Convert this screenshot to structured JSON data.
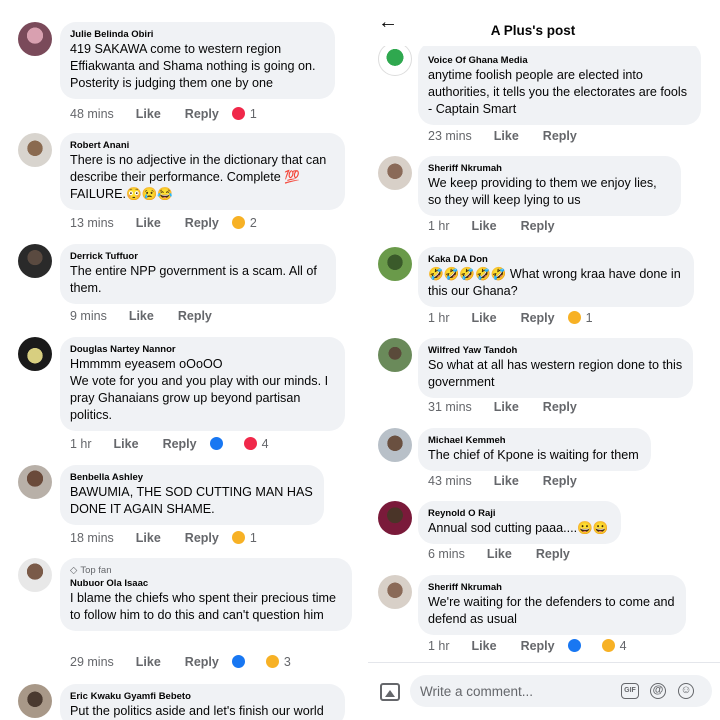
{
  "left_panel": {
    "comments": [
      {
        "author": "Julie Belinda Obiri",
        "text": "419 SAKAWA come to western region Effiakwanta and Shama nothing is going on. Posterity is judging them one by one",
        "time": "48 mins",
        "like": "Like",
        "reply": "Reply",
        "reaction_count": "1",
        "reactions": [
          "love"
        ]
      },
      {
        "author": "Robert Anani",
        "text": "There is no adjective in the dictionary that can describe their performance. Complete 💯 FAILURE.😳😢😂",
        "time": "13 mins",
        "like": "Like",
        "reply": "Reply",
        "reaction_count": "2",
        "reactions": [
          "haha"
        ]
      },
      {
        "author": "Derrick Tuffuor",
        "text": "The entire NPP government is a scam. All of them.",
        "time": "9 mins",
        "like": "Like",
        "reply": "Reply",
        "reaction_count": "",
        "reactions": []
      },
      {
        "author": "Douglas Nartey Nannor",
        "text": "Hmmmm eyeasem oOoOO\nWe vote for you and you play with our minds. I pray Ghanaians grow up beyond partisan politics.",
        "time": "1 hr",
        "like": "Like",
        "reply": "Reply",
        "reaction_count": "4",
        "reactions": [
          "like",
          "love"
        ]
      },
      {
        "author": "Benbella Ashley",
        "text": "BAWUMIA, THE SOD CUTTING  MAN HAS DONE IT AGAIN SHAME.",
        "time": "18 mins",
        "like": "Like",
        "reply": "Reply",
        "reaction_count": "1",
        "reactions": [
          "haha"
        ]
      },
      {
        "author": "Nubuor Ola Isaac",
        "badge": "Top fan",
        "text": "I blame the chiefs who spent their precious time to follow him to do this and can't question him",
        "time": "29 mins",
        "like": "Like",
        "reply": "Reply",
        "reaction_count": "3",
        "reactions": [
          "like",
          "haha"
        ]
      },
      {
        "author": "Eric Kwaku Gyamfi Bebeto",
        "text": "Put the politics aside and let's finish our world",
        "time": "",
        "like": "",
        "reply": "",
        "reaction_count": "",
        "reactions": []
      }
    ]
  },
  "right_panel": {
    "header": {
      "title": "A Plus's post",
      "back_icon": "arrow-left-icon"
    },
    "comments": [
      {
        "author": "Voice Of Ghana Media",
        "text": "anytime foolish people are elected into authorities, it tells you the electorates are fools - Captain Smart",
        "time": "23 mins",
        "like": "Like",
        "reply": "Reply",
        "reaction_count": "",
        "reactions": []
      },
      {
        "author": "Sheriff Nkrumah",
        "text": "We keep providing to them we enjoy lies, so they will keep lying to us",
        "time": "1 hr",
        "like": "Like",
        "reply": "Reply",
        "reaction_count": "",
        "reactions": []
      },
      {
        "author": "Kaka DA Don",
        "text": "🤣🤣🤣🤣🤣 What wrong kraa have done in this our Ghana?",
        "time": "1 hr",
        "like": "Like",
        "reply": "Reply",
        "reaction_count": "1",
        "reactions": [
          "haha"
        ]
      },
      {
        "author": "Wilfred Yaw Tandoh",
        "text": "So what at all has western region done to this government",
        "time": "31 mins",
        "like": "Like",
        "reply": "Reply",
        "reaction_count": "",
        "reactions": []
      },
      {
        "author": "Michael Kemmeh",
        "text": "The chief of Kpone is waiting for them",
        "time": "43 mins",
        "like": "Like",
        "reply": "Reply",
        "reaction_count": "",
        "reactions": []
      },
      {
        "author": "Reynold O Raji",
        "text": "Annual sod cutting paaa....😀😀",
        "time": "6 mins",
        "like": "Like",
        "reply": "Reply",
        "reaction_count": "",
        "reactions": []
      },
      {
        "author": "Sheriff Nkrumah",
        "text": "We're waiting for the defenders to come and defend as usual",
        "time": "1 hr",
        "like": "Like",
        "reply": "Reply",
        "reaction_count": "4",
        "reactions": [
          "like",
          "haha"
        ]
      }
    ],
    "composer": {
      "placeholder": "Write a comment...",
      "gif_label": "GIF",
      "icons": [
        "photo-icon",
        "gif-icon",
        "mention-icon",
        "emoji-icon"
      ]
    }
  },
  "colors": {
    "bubble": "#f0f2f5",
    "meta_text": "#65676b",
    "love": "#f0284a",
    "like": "#1877f2",
    "haha": "#f7b125"
  }
}
